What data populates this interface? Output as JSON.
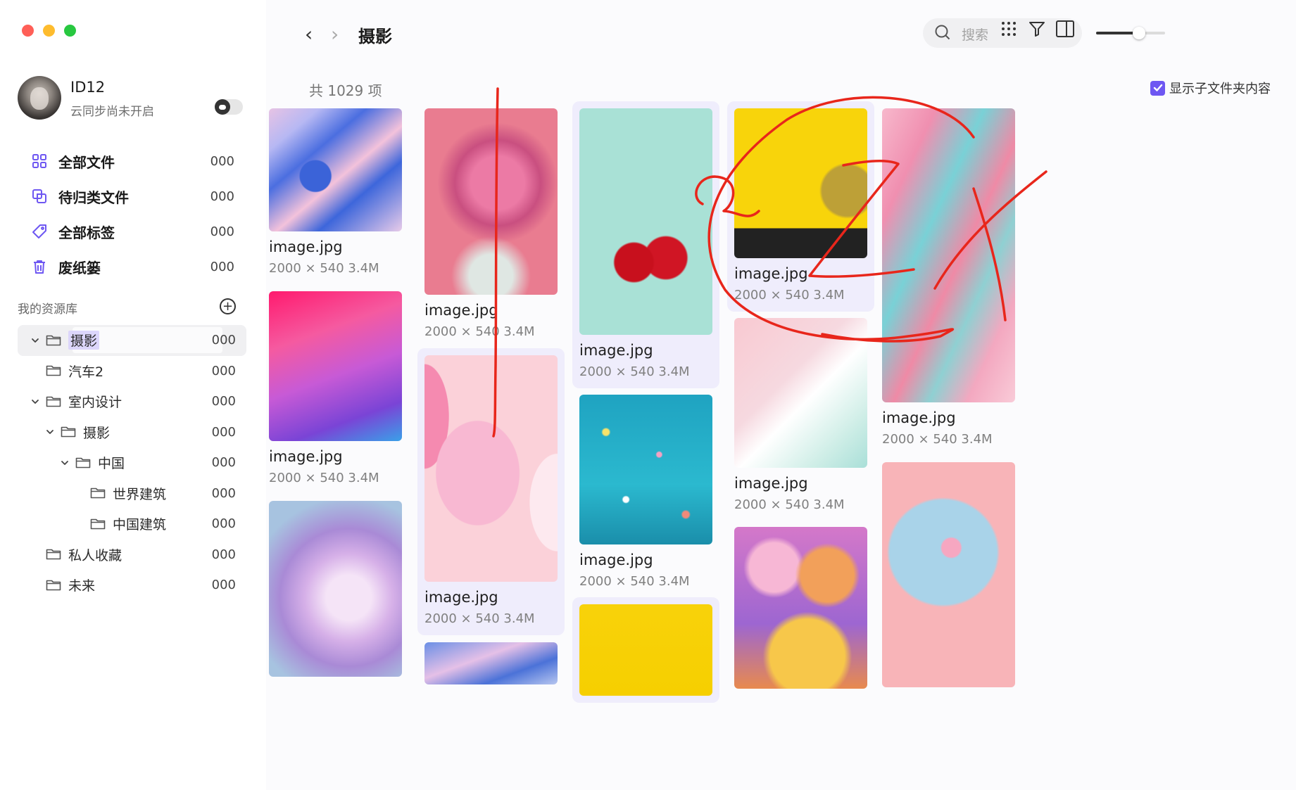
{
  "sidebar": {
    "profile": {
      "name": "ID12",
      "status": "云同步尚未开启"
    },
    "nav": [
      {
        "label": "全部文件",
        "count": "000",
        "icon": "grid-icon"
      },
      {
        "label": "待归类文件",
        "count": "000",
        "icon": "copy-icon"
      },
      {
        "label": "全部标签",
        "count": "000",
        "icon": "tag-icon"
      },
      {
        "label": "废纸篓",
        "count": "000",
        "icon": "trash-icon"
      }
    ],
    "library": {
      "title": "我的资源库",
      "add_symbol": "+",
      "tree": [
        {
          "label": "摄影",
          "count": "000",
          "depth": 0,
          "expanded": true,
          "selected": true
        },
        {
          "label": "汽车2",
          "count": "000",
          "depth": 0,
          "expanded": null,
          "selected": false
        },
        {
          "label": "室内设计",
          "count": "000",
          "depth": 0,
          "expanded": true,
          "selected": false
        },
        {
          "label": "摄影",
          "count": "000",
          "depth": 1,
          "expanded": true,
          "selected": false
        },
        {
          "label": "中国",
          "count": "000",
          "depth": 2,
          "expanded": true,
          "selected": false
        },
        {
          "label": "世界建筑",
          "count": "000",
          "depth": 3,
          "expanded": null,
          "selected": false
        },
        {
          "label": "中国建筑",
          "count": "000",
          "depth": 3,
          "expanded": null,
          "selected": false
        },
        {
          "label": "私人收藏",
          "count": "000",
          "depth": 0,
          "expanded": null,
          "selected": false
        },
        {
          "label": "未来",
          "count": "000",
          "depth": 0,
          "expanded": null,
          "selected": false
        }
      ]
    }
  },
  "header": {
    "back_symbol": "‹",
    "forward_symbol": "›",
    "title": "摄影",
    "search_placeholder": "搜索",
    "zoom_level": 0.62
  },
  "main": {
    "total_label": "共 1029 项",
    "show_subfolder_label": "显示子文件夹内容",
    "show_subfolder_checked": true,
    "items": [
      {
        "name": "image.jpg",
        "meta": "2000 × 540  3.4M",
        "image": "blue-pink-fluid-art",
        "highlighted": false
      },
      {
        "name": "image.jpg",
        "meta": "2000 × 540  3.4M",
        "image": "pink-gradient",
        "highlighted": false
      },
      {
        "name": "",
        "meta": "",
        "image": "purple-crystals",
        "highlighted": false
      },
      {
        "name": "image.jpg",
        "meta": "2000 × 540  3.4M",
        "image": "pink-roses",
        "highlighted": false
      },
      {
        "name": "image.jpg",
        "meta": "2000 × 540  3.4M",
        "image": "pink-balloons",
        "highlighted": true
      },
      {
        "name": "",
        "meta": "",
        "image": "blue-fluid-art",
        "highlighted": false
      },
      {
        "name": "image.jpg",
        "meta": "2000 × 540  3.4M",
        "image": "cherries-on-mint",
        "highlighted": true
      },
      {
        "name": "image.jpg",
        "meta": "2000 × 540  3.4M",
        "image": "teal-confetti",
        "highlighted": false
      },
      {
        "name": "",
        "meta": "",
        "image": "yellow-background",
        "highlighted": true
      },
      {
        "name": "image.jpg",
        "meta": "2000 × 540  3.4M",
        "image": "yellow-hat-person",
        "highlighted": true
      },
      {
        "name": "image.jpg",
        "meta": "2000 × 540  3.4M",
        "image": "pink-feather",
        "highlighted": false
      },
      {
        "name": "",
        "meta": "",
        "image": "colorful-bubbles",
        "highlighted": false
      },
      {
        "name": "image.jpg",
        "meta": "2000 × 540  3.4M",
        "image": "pink-teal-fluid-art",
        "highlighted": false
      },
      {
        "name": "",
        "meta": "",
        "image": "blue-plate-lollipop",
        "highlighted": false
      }
    ]
  },
  "colors": {
    "accent": "#6e57f2",
    "highlight_card": "#efedfc",
    "annotation_ink": "#e8261b"
  }
}
